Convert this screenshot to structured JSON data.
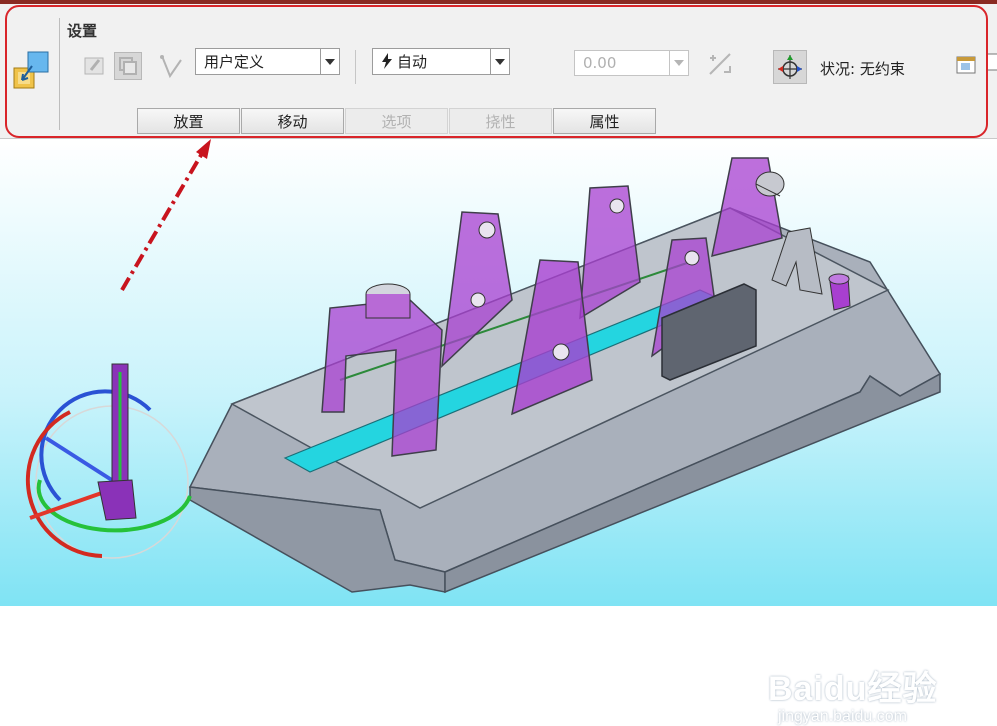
{
  "ribbon": {
    "title": "设置",
    "constraint_type": {
      "value": "用户定义"
    },
    "placement": {
      "value": "自动"
    },
    "offset": {
      "value": "0.00"
    },
    "status": "状况: 无约束"
  },
  "tabs": [
    {
      "label": "放置",
      "enabled": true
    },
    {
      "label": "移动",
      "enabled": true
    },
    {
      "label": "选项",
      "enabled": false
    },
    {
      "label": "挠性",
      "enabled": false
    },
    {
      "label": "属性",
      "enabled": true
    }
  ],
  "watermark": {
    "logo": "Baidu经验",
    "url": "jingyan.baidu.com"
  },
  "colors": {
    "highlight": "#d9252a",
    "arrow": "#c8141e",
    "part": "#a83fd0",
    "channel": "#24d5e0",
    "base": "#a9b0bb"
  },
  "icons": [
    "assembly-component-icon",
    "edit-icon",
    "move-component-icon",
    "point-constraint-icon",
    "flip-icon",
    "drag-3d-icon",
    "window-icon"
  ]
}
